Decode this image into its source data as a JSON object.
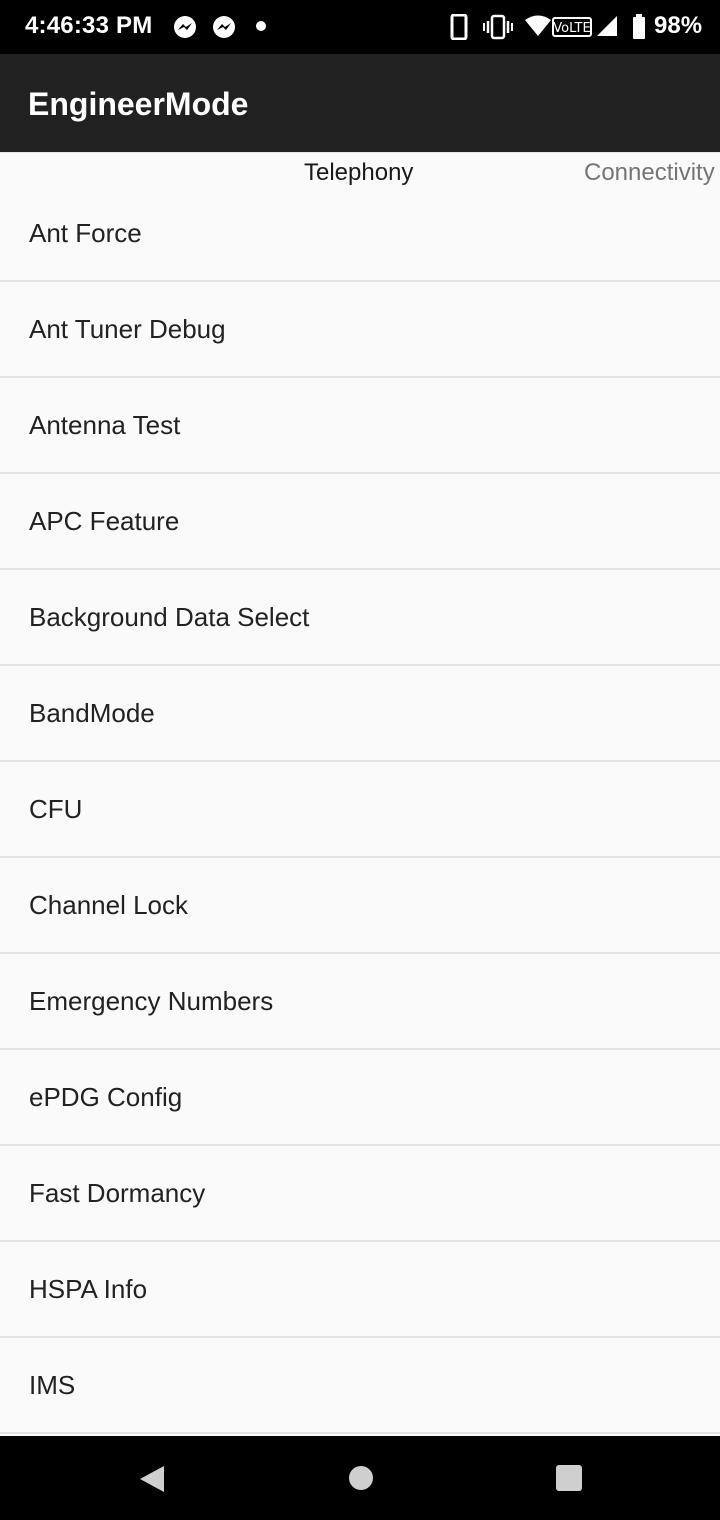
{
  "status_bar": {
    "time": "4:46:33 PM",
    "battery": "98%",
    "icons": [
      "messenger-icon",
      "messenger-icon",
      "dot-icon",
      "phone-icon",
      "vibrate-icon",
      "wifi-icon",
      "volte-icon",
      "signal-icon",
      "battery-icon"
    ]
  },
  "app_bar": {
    "title": "EngineerMode"
  },
  "tabs": [
    {
      "label": "Telephony",
      "selected": true
    },
    {
      "label": "Connectivity",
      "selected": false
    }
  ],
  "list": {
    "items": [
      {
        "label": "Ant Force"
      },
      {
        "label": "Ant Tuner Debug"
      },
      {
        "label": "Antenna Test"
      },
      {
        "label": "APC Feature"
      },
      {
        "label": "Background Data Select"
      },
      {
        "label": "BandMode"
      },
      {
        "label": "CFU"
      },
      {
        "label": "Channel Lock"
      },
      {
        "label": "Emergency Numbers"
      },
      {
        "label": "ePDG Config"
      },
      {
        "label": "Fast Dormancy"
      },
      {
        "label": "HSPA Info"
      },
      {
        "label": "IMS"
      }
    ]
  },
  "nav_bar": {
    "buttons": [
      "back-icon",
      "home-icon",
      "recent-apps-icon"
    ]
  }
}
